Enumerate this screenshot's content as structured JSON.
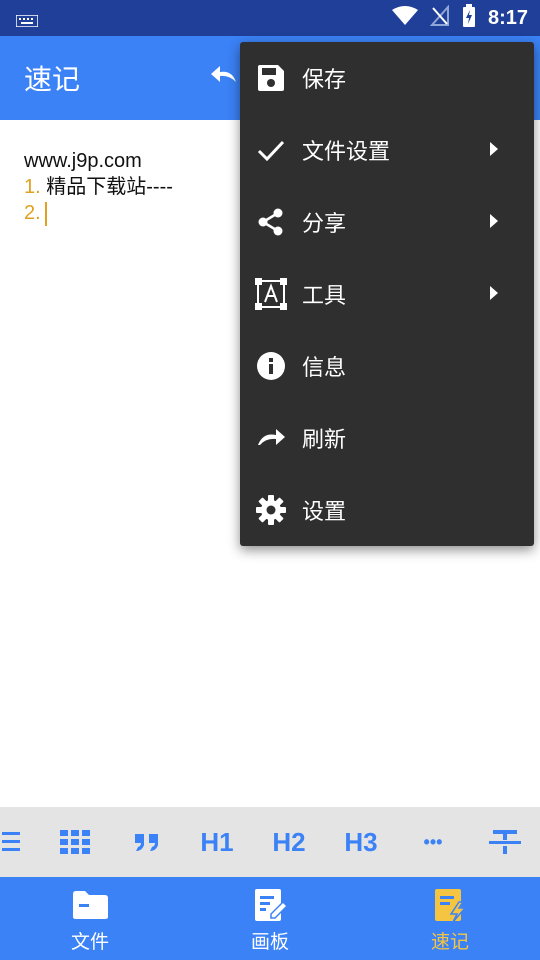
{
  "status_bar": {
    "time": "8:17"
  },
  "app_bar": {
    "title": "速记"
  },
  "editor": {
    "line1": "www.j9p.com",
    "line2_num": "1.",
    "line2_text": " 精品下载站----",
    "line3_num": "2."
  },
  "menu": {
    "items": [
      {
        "label": "保存",
        "icon": "save-icon"
      },
      {
        "label": "文件设置",
        "icon": "check-icon",
        "submenu": true
      },
      {
        "label": "分享",
        "icon": "share-icon",
        "submenu": true
      },
      {
        "label": "工具",
        "icon": "text-box-icon",
        "submenu": true
      },
      {
        "label": "信息",
        "icon": "info-icon"
      },
      {
        "label": "刷新",
        "icon": "redo-icon"
      },
      {
        "label": "设置",
        "icon": "gear-icon"
      }
    ]
  },
  "format_toolbar": {
    "h1": "H1",
    "h2": "H2",
    "h3": "H3",
    "more": "•••"
  },
  "bottom_nav": {
    "items": [
      {
        "label": "文件",
        "icon": "folder-icon"
      },
      {
        "label": "画板",
        "icon": "drawing-board-icon"
      },
      {
        "label": "速记",
        "icon": "quick-note-icon",
        "active": true
      }
    ]
  },
  "colors": {
    "status_bar": "#1f3f99",
    "primary": "#3b82f6",
    "menu_bg": "#2f2f2f",
    "accent": "#f5c542",
    "list_number": "#e0a020",
    "toolbar_bg": "#e4e4e4"
  }
}
